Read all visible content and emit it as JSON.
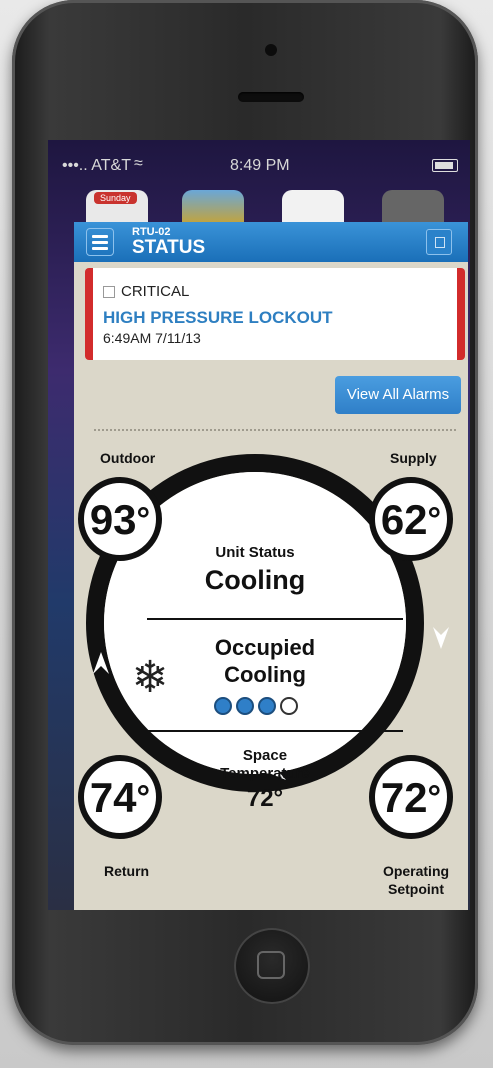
{
  "status_bar": {
    "carrier": "AT&T",
    "time": "8:49 PM"
  },
  "home_screen": {
    "calendar_label": "Sunday"
  },
  "header": {
    "subtitle": "RTU-02",
    "title": "STATUS"
  },
  "alarm": {
    "level": "CRITICAL",
    "title": "HIGH PRESSURE LOCKOUT",
    "timestamp": "6:49AM 7/11/13"
  },
  "actions": {
    "view_all_alarms": "View All Alarms"
  },
  "temps": {
    "outdoor_label": "Outdoor",
    "outdoor_value": "93",
    "supply_label": "Supply",
    "supply_value": "62",
    "return_label": "Return",
    "return_value": "74",
    "setpoint_label_line1": "Operating",
    "setpoint_label_line2": "Setpoint",
    "setpoint_value": "72",
    "degree_symbol": "°"
  },
  "center": {
    "unit_status_label": "Unit Status",
    "unit_status_value": "Cooling",
    "mode_line1": "Occupied",
    "mode_line2": "Cooling",
    "stage_filled": 3,
    "stage_total": 4,
    "space_temp_label_line1": "Space",
    "space_temp_label_line2": "Temperature",
    "space_temp_value": "72°"
  },
  "colors": {
    "accent": "#2e7fc1",
    "critical": "#d22b2b",
    "stage_on": "#2f7fc8"
  },
  "icons": {
    "mode_icon": "snowflake-icon"
  }
}
